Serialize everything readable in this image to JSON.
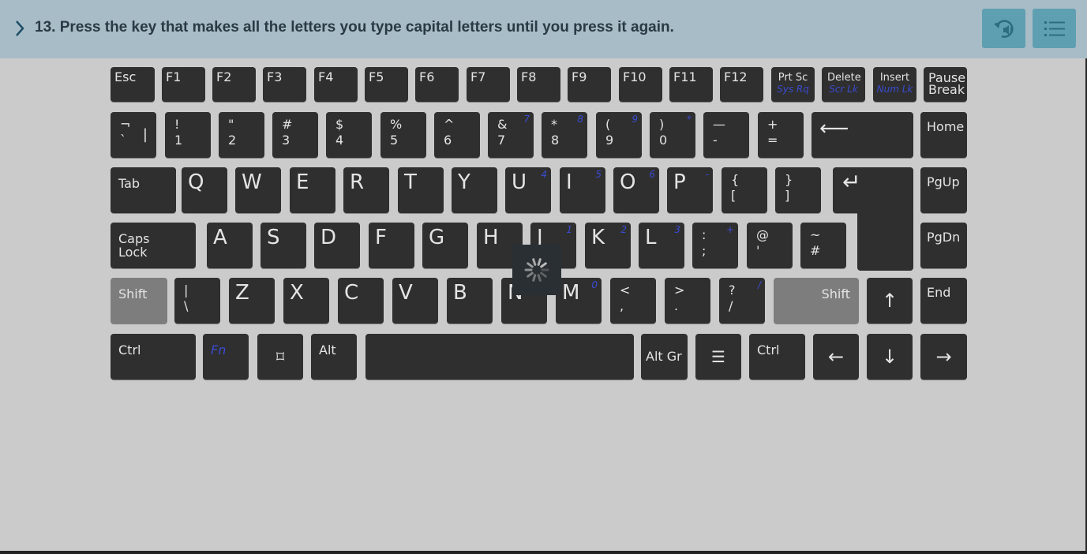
{
  "header": {
    "question": "13. Press the key that makes all the letters you type capital letters until you press it again.",
    "chevron_icon": "chevron-right-icon",
    "replay_audio_icon": "replay-audio-icon",
    "menu_icon": "list-menu-icon",
    "accent_color": "#5f9fb2",
    "bar_color": "#a7bcc6"
  },
  "keyboard": {
    "row_fn": [
      {
        "name": "esc",
        "label": "Esc"
      },
      {
        "name": "f1",
        "label": "F1"
      },
      {
        "name": "f2",
        "label": "F2"
      },
      {
        "name": "f3",
        "label": "F3"
      },
      {
        "name": "f4",
        "label": "F4"
      },
      {
        "name": "f5",
        "label": "F5"
      },
      {
        "name": "f6",
        "label": "F6"
      },
      {
        "name": "f7",
        "label": "F7"
      },
      {
        "name": "f8",
        "label": "F8"
      },
      {
        "name": "f9",
        "label": "F9"
      },
      {
        "name": "f10",
        "label": "F10"
      },
      {
        "name": "f11",
        "label": "F11"
      },
      {
        "name": "f12",
        "label": "F12"
      },
      {
        "name": "prtsc",
        "label": "Prt Sc",
        "sub": "Sys Rq"
      },
      {
        "name": "delete",
        "label": "Delete",
        "sub": "Scr Lk"
      },
      {
        "name": "insert",
        "label": "Insert",
        "sub": "Num Lk"
      },
      {
        "name": "pause",
        "label": "Pause\nBreak"
      }
    ],
    "row_num": [
      {
        "name": "grave",
        "top": "¬",
        "bot": "`",
        "right": "|"
      },
      {
        "name": "1",
        "top": "!",
        "bot": "1"
      },
      {
        "name": "2",
        "top": "\"",
        "bot": "2"
      },
      {
        "name": "3",
        "top": "#",
        "bot": "3"
      },
      {
        "name": "4",
        "top": "$",
        "bot": "4"
      },
      {
        "name": "5",
        "top": "%",
        "bot": "5"
      },
      {
        "name": "6",
        "top": "^",
        "bot": "6"
      },
      {
        "name": "7",
        "top": "&",
        "bot": "7",
        "alt": "7"
      },
      {
        "name": "8",
        "top": "*",
        "bot": "8",
        "alt": "8"
      },
      {
        "name": "9",
        "top": "(",
        "bot": "9",
        "alt": "9"
      },
      {
        "name": "0",
        "top": ")",
        "bot": "0",
        "alt": "*"
      },
      {
        "name": "minus",
        "top": "—",
        "bot": "-"
      },
      {
        "name": "equals",
        "top": "+",
        "bot": "="
      },
      {
        "name": "backspace",
        "label": "⟵"
      },
      {
        "name": "home",
        "label": "Home"
      }
    ],
    "row_q": [
      {
        "name": "tab",
        "label": "Tab"
      },
      {
        "name": "q",
        "label": "Q"
      },
      {
        "name": "w",
        "label": "W"
      },
      {
        "name": "e",
        "label": "E"
      },
      {
        "name": "r",
        "label": "R"
      },
      {
        "name": "t",
        "label": "T"
      },
      {
        "name": "y",
        "label": "Y"
      },
      {
        "name": "u",
        "label": "U",
        "alt": "4"
      },
      {
        "name": "i",
        "label": "I",
        "alt": "5"
      },
      {
        "name": "o",
        "label": "O",
        "alt": "6"
      },
      {
        "name": "p",
        "label": "P",
        "alt": "-"
      },
      {
        "name": "lbracket",
        "top": "{",
        "bot": "["
      },
      {
        "name": "rbracket",
        "top": "}",
        "bot": "]"
      },
      {
        "name": "enter",
        "label": "↵"
      },
      {
        "name": "pgup",
        "label": "PgUp"
      }
    ],
    "row_a": [
      {
        "name": "capslock",
        "label": "Caps\nLock"
      },
      {
        "name": "a",
        "label": "A"
      },
      {
        "name": "s",
        "label": "S"
      },
      {
        "name": "d",
        "label": "D"
      },
      {
        "name": "f",
        "label": "F"
      },
      {
        "name": "g",
        "label": "G"
      },
      {
        "name": "h",
        "label": "H"
      },
      {
        "name": "j",
        "label": "J",
        "alt": "1"
      },
      {
        "name": "k",
        "label": "K",
        "alt": "2"
      },
      {
        "name": "l",
        "label": "L",
        "alt": "3"
      },
      {
        "name": "semicolon",
        "top": ":",
        "bot": ";",
        "alt": "+"
      },
      {
        "name": "quote",
        "top": "@",
        "bot": "'"
      },
      {
        "name": "hash",
        "top": "~",
        "bot": "#"
      },
      {
        "name": "pgdn",
        "label": "PgDn"
      }
    ],
    "row_z": [
      {
        "name": "lshift",
        "label": "Shift"
      },
      {
        "name": "backslash",
        "top": "|",
        "bot": "\\"
      },
      {
        "name": "z",
        "label": "Z"
      },
      {
        "name": "x",
        "label": "X"
      },
      {
        "name": "c",
        "label": "C"
      },
      {
        "name": "v",
        "label": "V"
      },
      {
        "name": "b",
        "label": "B"
      },
      {
        "name": "n",
        "label": "N"
      },
      {
        "name": "m",
        "label": "M",
        "alt": "0"
      },
      {
        "name": "comma",
        "top": "<",
        "bot": ","
      },
      {
        "name": "period",
        "top": ">",
        "bot": "."
      },
      {
        "name": "slash",
        "top": "?",
        "bot": "/",
        "alt": "/"
      },
      {
        "name": "rshift",
        "label": "Shift"
      },
      {
        "name": "up",
        "label": "↑"
      },
      {
        "name": "end",
        "label": "End"
      }
    ],
    "row_space": [
      {
        "name": "lctrl",
        "label": "Ctrl"
      },
      {
        "name": "fn",
        "label": "Fn"
      },
      {
        "name": "win",
        "label": "⌑"
      },
      {
        "name": "alt",
        "label": "Alt"
      },
      {
        "name": "space",
        "label": ""
      },
      {
        "name": "altgr",
        "label": "Alt Gr"
      },
      {
        "name": "context-menu",
        "label": "☰"
      },
      {
        "name": "rctrl",
        "label": "Ctrl"
      },
      {
        "name": "left",
        "label": "←"
      },
      {
        "name": "down",
        "label": "↓"
      },
      {
        "name": "right",
        "label": "→"
      }
    ],
    "loading_icon": "loading-spinner-icon"
  }
}
